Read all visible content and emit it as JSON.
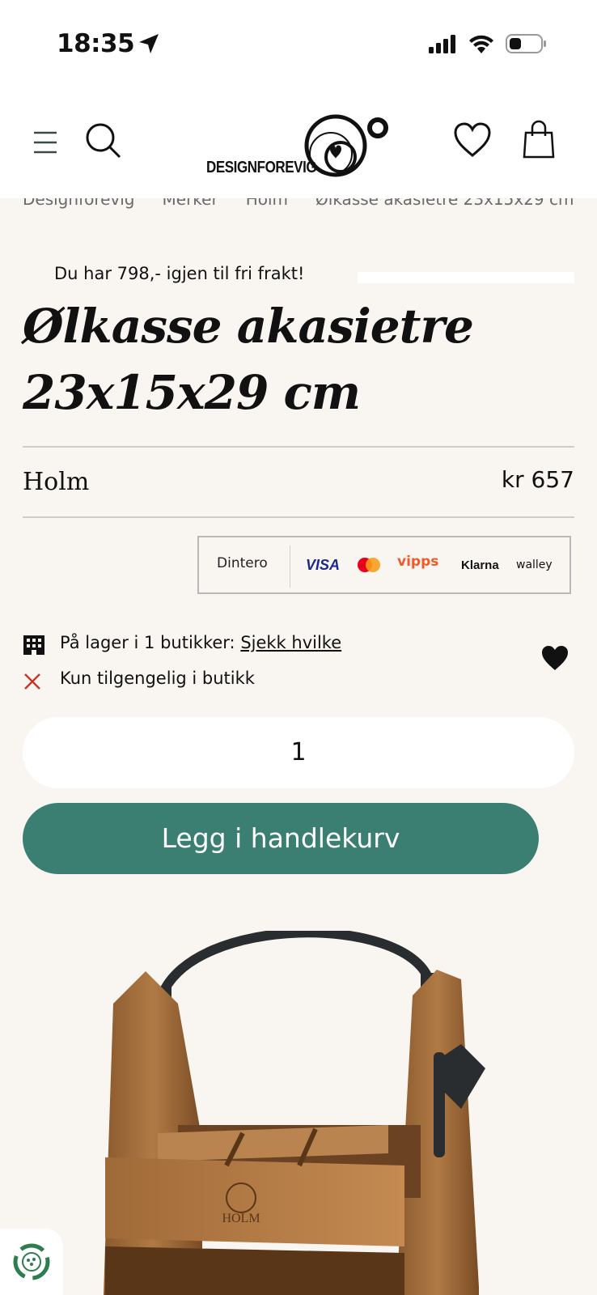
{
  "status_bar": {
    "time": "18:35"
  },
  "header": {
    "logo_text": "DESIGNFOREVIG"
  },
  "breadcrumb": {
    "items": [
      "Designforevig",
      "Merker",
      "Holm",
      "Ølkasse akasietre 23x15x29 cm"
    ]
  },
  "free_shipping": {
    "text": "Du har 798,- igjen til fri frakt!",
    "progress": 0.0
  },
  "product": {
    "title": "Ølkasse akasietre 23x15x29 cm",
    "brand": "Holm",
    "price": "kr 657",
    "stock_label": "På lager i 1 butikker:",
    "stock_link": "Sjekk hvilke",
    "availability": "Kun tilgengelig i butikk",
    "quantity": "1",
    "add_to_cart": "Legg i handlekurv"
  },
  "payments": {
    "dintero": "Dintero",
    "visa": "VISA",
    "vipps": "vipps",
    "klarna": "Klarna",
    "walley": "walley"
  },
  "colors": {
    "accent": "#3a7f71",
    "background": "#f9f6f2",
    "unavailable": "#c0392b"
  }
}
